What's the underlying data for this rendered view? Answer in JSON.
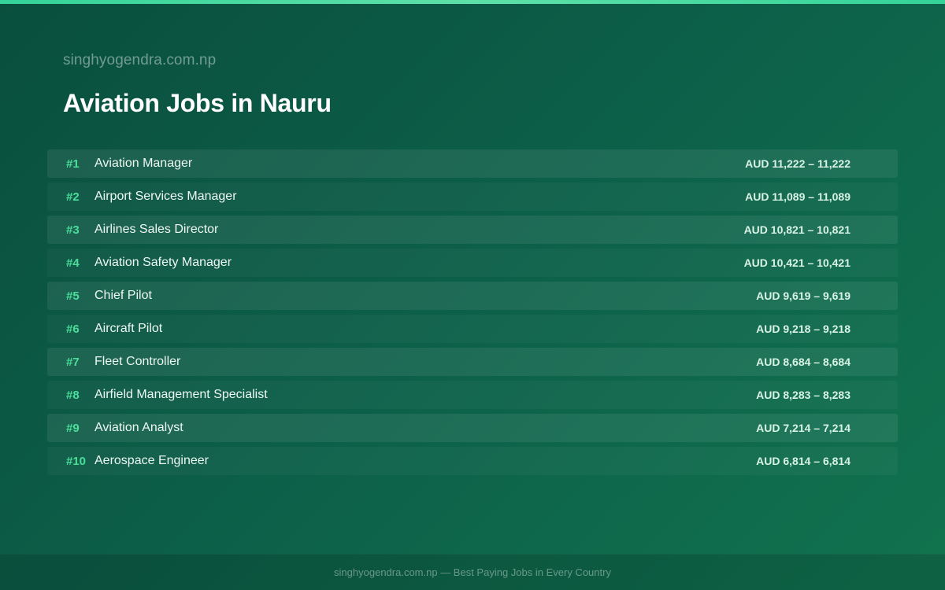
{
  "header": {
    "site": "singhyogendra.com.np",
    "title": "Aviation Jobs in Nauru"
  },
  "jobs": [
    {
      "rank": "#1",
      "title": "Aviation Manager",
      "salary": "AUD 11,222 – 11,222"
    },
    {
      "rank": "#2",
      "title": "Airport Services Manager",
      "salary": "AUD 11,089 – 11,089"
    },
    {
      "rank": "#3",
      "title": "Airlines Sales Director",
      "salary": "AUD 10,821 – 10,821"
    },
    {
      "rank": "#4",
      "title": "Aviation Safety Manager",
      "salary": "AUD 10,421 – 10,421"
    },
    {
      "rank": "#5",
      "title": "Chief Pilot",
      "salary": "AUD 9,619 – 9,619"
    },
    {
      "rank": "#6",
      "title": "Aircraft Pilot",
      "salary": "AUD 9,218 – 9,218"
    },
    {
      "rank": "#7",
      "title": "Fleet Controller",
      "salary": "AUD 8,684 – 8,684"
    },
    {
      "rank": "#8",
      "title": "Airfield Management Specialist",
      "salary": "AUD 8,283 – 8,283"
    },
    {
      "rank": "#9",
      "title": "Aviation Analyst",
      "salary": "AUD 7,214 – 7,214"
    },
    {
      "rank": "#10",
      "title": "Aerospace Engineer",
      "salary": "AUD 6,814 – 6,814"
    }
  ],
  "footer": {
    "text": "singhyogendra.com.np — Best Paying Jobs in Every Country"
  },
  "colors": {
    "accent": "#34d399",
    "rank": "#4ade9a",
    "background": "#0c5e48"
  }
}
